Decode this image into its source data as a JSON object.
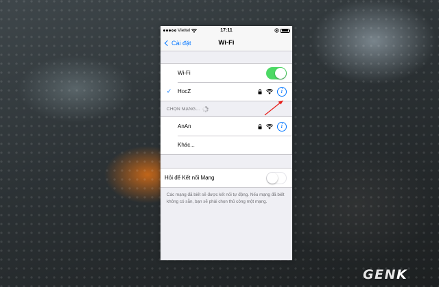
{
  "status_bar": {
    "carrier": "Viettel",
    "time": "17:11",
    "icons": [
      "signal-dots-icon",
      "wifi-icon",
      "lock-rotation-icon",
      "battery-icon"
    ]
  },
  "nav": {
    "back_label": "Cài đặt",
    "title": "Wi-Fi"
  },
  "wifi": {
    "label": "Wi-Fi",
    "enabled": true
  },
  "connected_network": {
    "name": "HocZ",
    "secured": true,
    "icons": [
      "checkmark-icon",
      "lock-icon",
      "wifi-signal-icon",
      "info-icon"
    ]
  },
  "choose_network": {
    "header": "CHỌN MẠNG...",
    "networks": [
      {
        "name": "AnAn",
        "secured": true
      }
    ],
    "other_label": "Khác..."
  },
  "ask_to_join": {
    "label": "Hỏi để Kết nối Mạng",
    "enabled": false,
    "footer": "Các mạng đã biết sẽ được kết nối tự động. Nếu mạng đã biết không có sẵn, bạn sẽ phải chọn thủ công một mạng."
  },
  "annotation": {
    "color": "#e8201c",
    "icon": "red-arrow-icon"
  },
  "watermark": {
    "text_main": "GEN",
    "text_accent": "K"
  },
  "colors": {
    "ios_blue": "#0a7aff",
    "toggle_green": "#4cd964"
  }
}
